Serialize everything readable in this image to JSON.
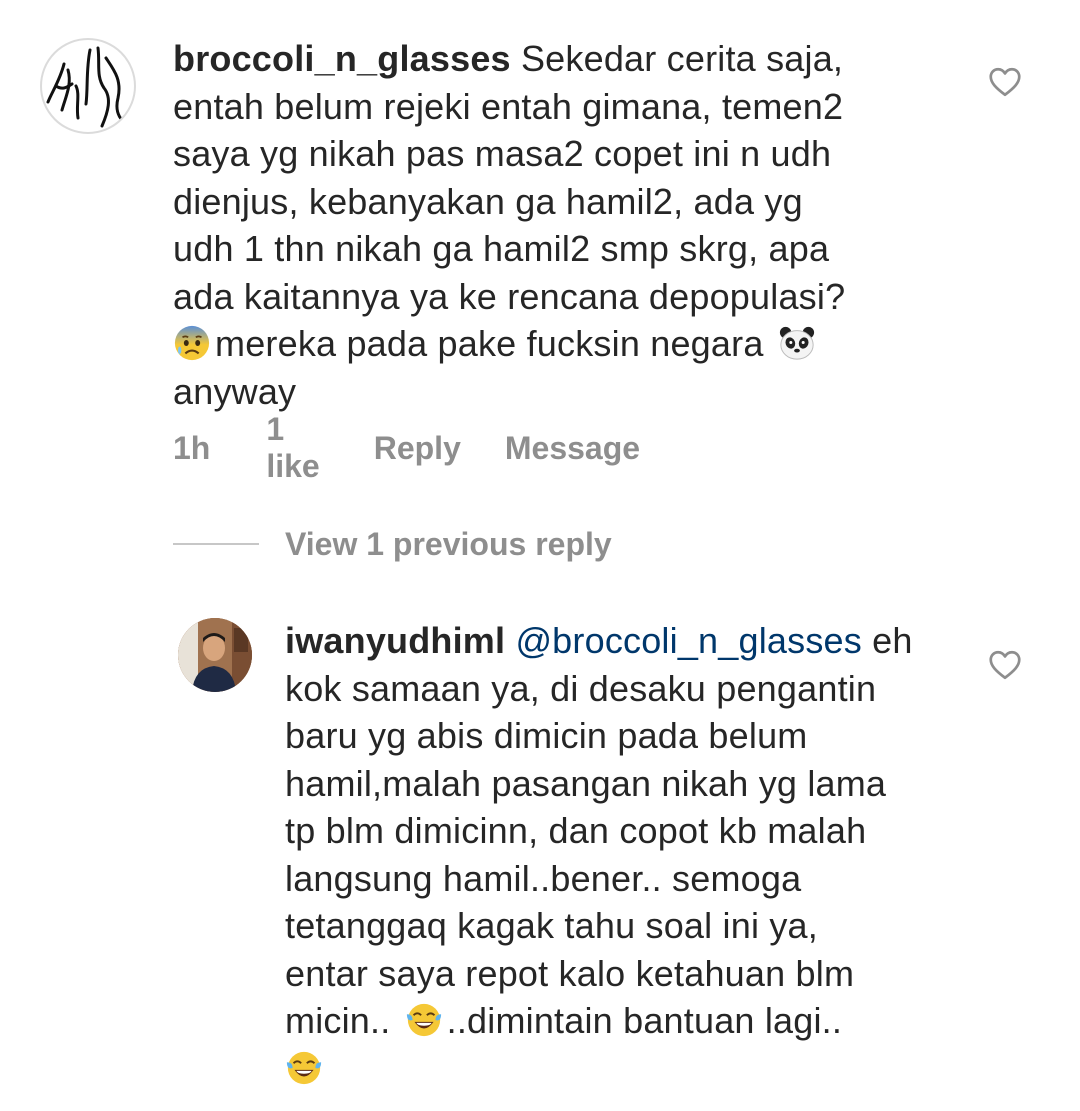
{
  "comment": {
    "username": "broccoli_n_glasses",
    "lines": [
      "Sekedar cerita saja,",
      "entah belum rejeki entah gimana, temen2",
      "saya yg nikah pas masa2 copet ini n udh",
      "dienjus, kebanyakan ga hamil2, ada yg",
      "udh 1 thn nikah ga hamil2 smp skrg, apa",
      "ada kaitannya ya ke rencana depopulasi?"
    ],
    "line7_text": "mereka pada pake fucksin negara",
    "line8": "anyway",
    "emoji_1": "anxious-face-with-sweat-icon",
    "emoji_2": "panda-face-icon",
    "time": "1h",
    "likes": "1 like",
    "reply_label": "Reply",
    "message_label": "Message"
  },
  "view_replies_label": "View 1 previous reply",
  "reply": {
    "username": "iwanyudhiml",
    "mention": "@broccoli_n_glasses",
    "line1_end": "eh",
    "lines": [
      "kok samaan ya, di desaku pengantin",
      "baru yg abis dimicin pada belum",
      "hamil,malah pasangan nikah yg lama",
      "tp blm dimicinn, dan copot kb malah",
      "langsung hamil..bener.. semoga",
      "tetanggaq kagak tahu soal ini ya,",
      "entar saya repot kalo ketahuan blm"
    ],
    "line9_start": "micin..",
    "line9_end": "..dimintain bantuan lagi..",
    "emoji": "face-with-tears-of-joy-icon"
  },
  "colors": {
    "text": "#262626",
    "meta": "#8e8e8e",
    "mention": "#00376b",
    "divider": "#c7c7c7"
  }
}
